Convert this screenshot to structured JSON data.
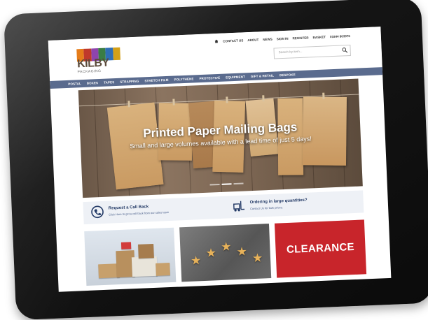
{
  "brand": {
    "name": "KILBY",
    "sub": "PACKAGING",
    "colors": [
      "#e57c1a",
      "#c0392b",
      "#8e44ad",
      "#3a7d44",
      "#2f6eb5",
      "#d4a017"
    ]
  },
  "topnav": {
    "items": [
      "CONTACT US",
      "ABOUT",
      "NEWS",
      "SIGN IN",
      "REGISTER",
      "BASKET"
    ],
    "phone": "01844 803976"
  },
  "search": {
    "placeholder": "Search by item..."
  },
  "catnav": {
    "items": [
      "POSTAL",
      "BOXES",
      "TAPES",
      "STRAPPING",
      "STRETCH FILM",
      "POLYTHENE",
      "PROTECTIVE",
      "EQUIPMENT",
      "GIFT & RETAIL",
      "BESPOKE"
    ]
  },
  "hero": {
    "title": "Printed Paper Mailing Bags",
    "subtitle": "Small and large volumes available with a lead time of just 5 days!"
  },
  "strip": {
    "callback": {
      "title": "Request a Call Back",
      "text": "Click Here to get a call back from our sales team"
    },
    "bulk": {
      "title": "Ordering in large quantities?",
      "text": "Contact Us for bulk prices."
    }
  },
  "tiles": {
    "clearance": "CLEARANCE"
  },
  "colors": {
    "nav": "#5a6b8e",
    "clearance": "#c8252b",
    "accent": "#233a66"
  }
}
